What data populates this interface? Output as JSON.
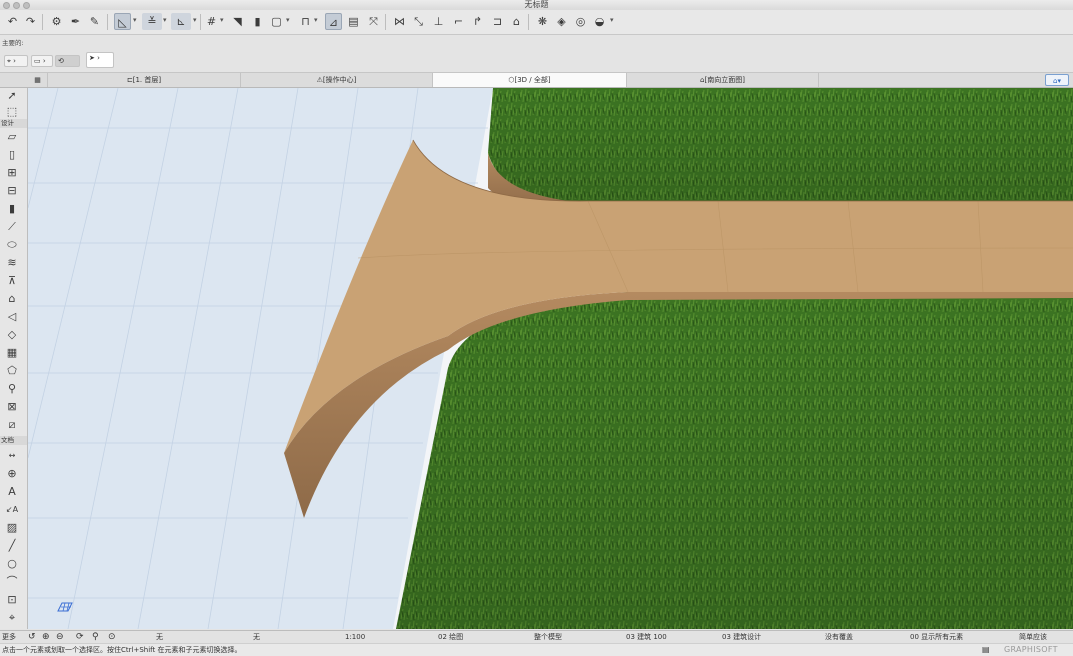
{
  "window": {
    "title": "无标题"
  },
  "info_box": {
    "label": "主要的:"
  },
  "tabs": [
    {
      "label": "[1. 首层]"
    },
    {
      "label": "[操作中心]"
    },
    {
      "label": "[3D / 全部]"
    },
    {
      "label": "[南向立面图]"
    }
  ],
  "left_toolbox": {
    "design_header": "设计",
    "document_header": "文档",
    "more_label": "更多"
  },
  "quick_options": [
    {
      "value": "无"
    },
    {
      "value": "无"
    },
    {
      "value": "1:100"
    },
    {
      "value": "02 绘图"
    },
    {
      "value": "整个模型"
    },
    {
      "value": "03 建筑 100"
    },
    {
      "value": "03 建筑设计"
    },
    {
      "value": "没有覆盖"
    },
    {
      "value": "00 显示所有元素"
    },
    {
      "value": "简单应该"
    }
  ],
  "status": {
    "hint": "点击一个元素或划取一个选择区。按住Ctrl+Shift 在元素和子元素切换选择。",
    "brand": "GRAPHISOFT"
  },
  "colors": {
    "grass": "#3f7a24",
    "shell_top": "#c9a274",
    "shell_side": "#a07a54",
    "grid_ground": "#dce6f1"
  }
}
